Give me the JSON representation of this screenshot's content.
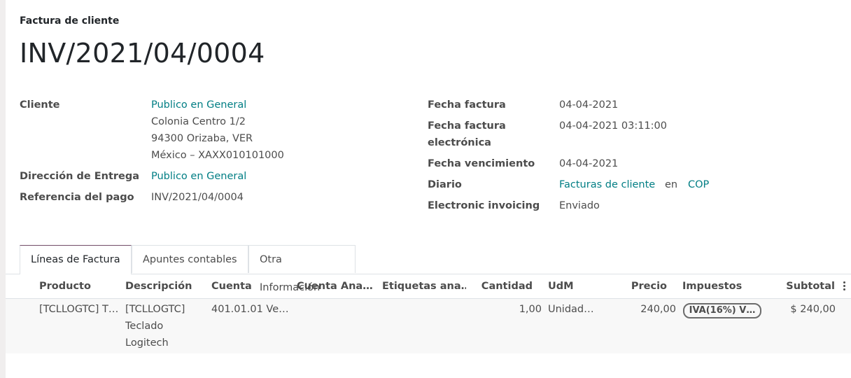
{
  "header": {
    "doc_type": "Factura de cliente",
    "doc_name": "INV/2021/04/0004"
  },
  "left_fields": {
    "cliente_label": "Cliente",
    "cliente_name": "Publico en General",
    "address_line1": "Colonia Centro 1/2",
    "address_line2": "94300 Orizaba, VER",
    "address_line3": "México – XAXX010101000",
    "entrega_label": "Dirección de Entrega",
    "entrega_value": "Publico en General",
    "referencia_label": "Referencia del pago",
    "referencia_value": "INV/2021/04/0004"
  },
  "right_fields": {
    "fecha_label": "Fecha factura",
    "fecha_value": "04-04-2021",
    "fecha_elec_label1": "Fecha factura",
    "fecha_elec_label2": "electrónica",
    "fecha_elec_value": "04-04-2021 03:11:00",
    "vencimiento_label": "Fecha vencimiento",
    "vencimiento_value": "04-04-2021",
    "diario_label": "Diario",
    "diario_value": "Facturas de cliente",
    "diario_en": "en",
    "diario_currency": "COP",
    "einvoicing_label": "Electronic invoicing",
    "einvoicing_value": "Enviado"
  },
  "tabs": [
    {
      "label": "Líneas de Factura",
      "active": true
    },
    {
      "label": "Apuntes contables",
      "active": false
    },
    {
      "label": "Otra Información",
      "active": false
    }
  ],
  "table": {
    "columns": [
      "Producto",
      "Descripción",
      "Cuenta",
      "Cuenta Ana…",
      "Etiquetas ana…",
      "Cantidad",
      "UdM",
      "Precio",
      "Impuestos",
      "Subtotal"
    ],
    "row": {
      "producto": "[TCLLOGTC] T…",
      "descripcion_line1": "[TCLLOGTC]",
      "descripcion_line2": "Teclado",
      "descripcion_line3": "Logitech",
      "cuenta": "401.01.01 Ve…",
      "cantidad": "1,00",
      "udm": "Unidad…",
      "precio": "240,00",
      "impuestos": "IVA(16%) V…",
      "subtotal": "$ 240,00"
    }
  },
  "colors": {
    "link": "#017e84",
    "active_tab": "#714b67"
  },
  "icons": {
    "optional_columns": "kebab-vertical-icon"
  }
}
